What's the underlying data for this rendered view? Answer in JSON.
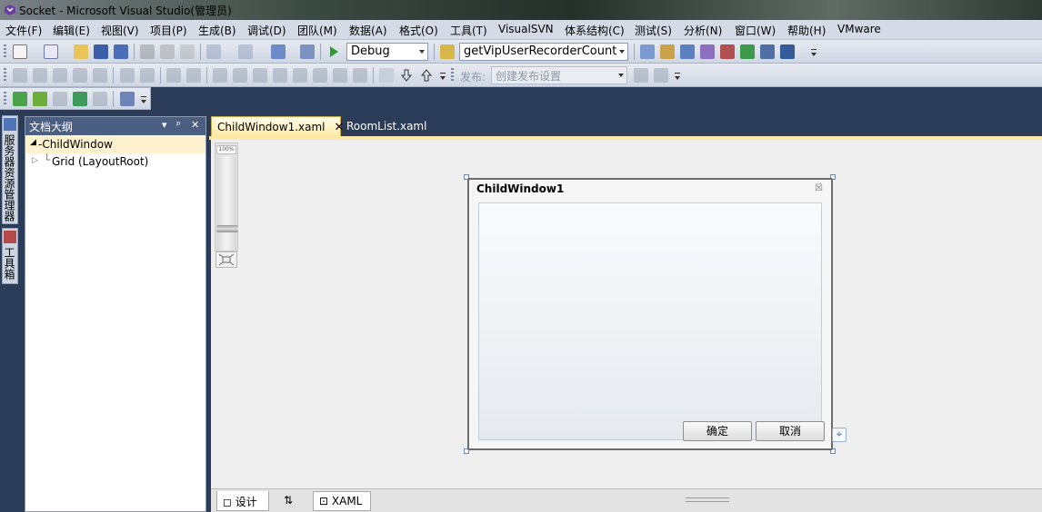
{
  "window": {
    "title": "Socket - Microsoft Visual Studio(管理员)"
  },
  "menu": [
    "文件(F)",
    "编辑(E)",
    "视图(V)",
    "项目(P)",
    "生成(B)",
    "调试(D)",
    "团队(M)",
    "数据(A)",
    "格式(O)",
    "工具(T)",
    "VisualSVN",
    "体系结构(C)",
    "测试(S)",
    "分析(N)",
    "窗口(W)",
    "帮助(H)",
    "VMware"
  ],
  "toolbar": {
    "configuration": "Debug",
    "find_combo": "getVipUserRecorderCount",
    "publish_label": "发布:",
    "publish_combo": "创建发布设置"
  },
  "side_tabs": {
    "server_explorer": "服务器资源管理器",
    "toolbox": "工具箱"
  },
  "outline": {
    "title": "文档大纲",
    "items": [
      {
        "label": "ChildWindow",
        "selected": true
      },
      {
        "label": "Grid (LayoutRoot)",
        "selected": false
      }
    ]
  },
  "doc_tabs": [
    {
      "label": "ChildWindow1.xaml",
      "active": true
    },
    {
      "label": "RoomList.xaml",
      "active": false
    }
  ],
  "designer": {
    "zoom": "100%",
    "child_window": {
      "title": "ChildWindow1",
      "ok_label": "确定",
      "cancel_label": "取消"
    }
  },
  "bottom_tabs": {
    "design": "设计",
    "swap": "⇅",
    "xaml": "XAML"
  },
  "colors": {
    "chrome": "#2b3c59",
    "active_tab": "#ffe9a6",
    "outline_header": "#4b5f83"
  }
}
